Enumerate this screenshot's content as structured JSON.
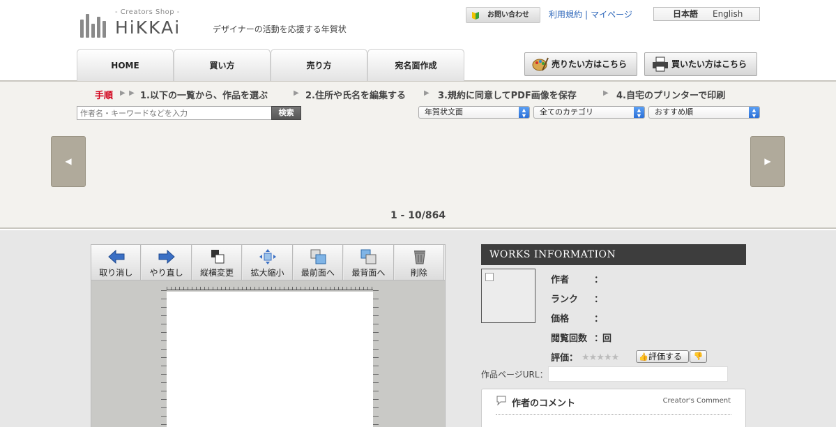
{
  "header": {
    "logo_tag": "- Creators Shop -",
    "logo_name": "HiKKAi",
    "tagline": "デザイナーの活動を応援する年賀状",
    "contact_label": "お問い合わせ",
    "links": [
      "利用規約",
      "マイページ"
    ],
    "link_separator": "|",
    "lang_ja": "日本語",
    "lang_en": "English",
    "nav": [
      "HOME",
      "買い方",
      "売り方",
      "宛名面作成"
    ],
    "sell_label": "売りたい方はこちら",
    "buy_label": "買いたい方はこちら"
  },
  "steps": {
    "label": "手順",
    "arrow": "▶ ▶",
    "step_arrow": "▶",
    "items": [
      "1.以下の一覧から、作品を選ぶ",
      "2.住所や氏名を編集する",
      "3.規約に同意してPDF画像を保存",
      "4.自宅のプリンターで印刷"
    ]
  },
  "search": {
    "placeholder": "作者名・キーワードなどを入力",
    "button": "検索"
  },
  "filters": [
    "年賀状文面",
    "全てのカテゴリ",
    "おすすめ順"
  ],
  "slider": {
    "prev": "◀",
    "next": "▶",
    "counter": "1 - 10/864"
  },
  "toolbar": [
    "取り消し",
    "やり直し",
    "縦横変更",
    "拡大縮小",
    "最前面へ",
    "最背面へ",
    "削除"
  ],
  "works_info": {
    "title": "WORKS INFORMATION",
    "rows": [
      {
        "label": "作者",
        "colon": "：",
        "value": ""
      },
      {
        "label": "ランク",
        "colon": "：",
        "value": ""
      },
      {
        "label": "価格",
        "colon": "：",
        "value": ""
      },
      {
        "label": "閲覧回数",
        "colon": "：",
        "value": "回"
      }
    ],
    "rating_label": "評価：",
    "stars": "★★★★★",
    "eval_button": "評価する",
    "url_label": "作品ページURL：",
    "comment_title": "作者のコメント",
    "comment_sub": "Creator's Comment"
  },
  "colors": {
    "accent_red": "#d2001a",
    "link_blue": "#2a64b9",
    "band_bg": "#f3f2ee",
    "slider_btn": "#b0aa9b",
    "info_title_bg": "#3d3d3d"
  }
}
